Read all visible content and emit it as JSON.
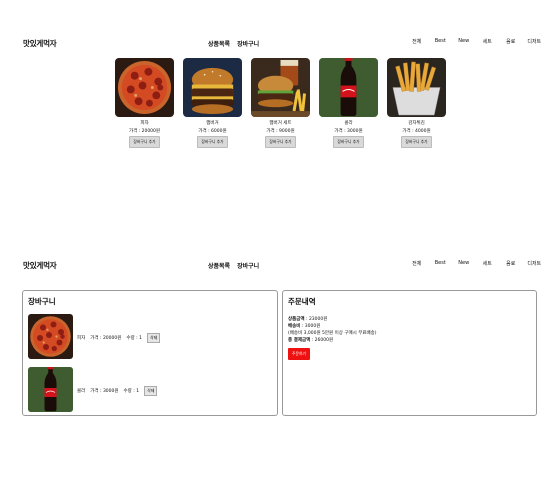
{
  "header": {
    "logo": "맛있게먹자",
    "nav": [
      "상품목록",
      "장바구니"
    ],
    "categories": [
      "전체",
      "Best",
      "New",
      "세트",
      "음료",
      "디저트"
    ]
  },
  "products": [
    {
      "name": "피자",
      "price": "가격 : 20000원",
      "button": "장바구니 추가",
      "icon": "pizza-icon"
    },
    {
      "name": "햄버거",
      "price": "가격 : 6000원",
      "button": "장바구니 추가",
      "icon": "burger-icon"
    },
    {
      "name": "햄버거 세트",
      "price": "가격 : 9000원",
      "button": "장바구니 추가",
      "icon": "burger-set-icon"
    },
    {
      "name": "콜라",
      "price": "가격 : 3000원",
      "button": "장바구니 추가",
      "icon": "cola-icon"
    },
    {
      "name": "감자튀김",
      "price": "가격 : 4000원",
      "button": "장바구니 추가",
      "icon": "fries-icon"
    }
  ],
  "cart": {
    "title": "장바구니",
    "items": [
      {
        "name": "피자",
        "price": "가격 : 20000원",
        "qty": "수량 : 1",
        "delete": "삭제"
      },
      {
        "name": "콜라",
        "price": "가격 : 3000원",
        "qty": "수량 : 1",
        "delete": "삭제"
      }
    ]
  },
  "order": {
    "title": "주문내역",
    "lines": [
      {
        "label": "상품금액",
        "value": " : 23000원"
      },
      {
        "label": "배송비",
        "value": " : 3000원"
      },
      {
        "label": "",
        "value": "(배송비 3,000원 5만원 이상 구매시 무료배송)"
      },
      {
        "label": "총 결제금액",
        "value": " : 26000원"
      }
    ],
    "button": "주문하기"
  },
  "colors": {
    "accent": "#ee1111",
    "button_gray": "#d9d9d9",
    "border": "#999999"
  }
}
